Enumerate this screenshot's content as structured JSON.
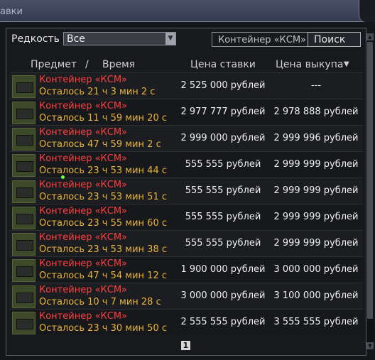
{
  "window": {
    "title": "авки"
  },
  "filter": {
    "rarity_label": "Редкость",
    "rarity_value": "Все",
    "search_value": "Контейнер «КСМ»",
    "search_button": "Поиск"
  },
  "table": {
    "col_item": "Предмет",
    "col_sep": "/",
    "col_time": "Время",
    "col_bid": "Цена ставки",
    "col_buyout": "Цена выкупа",
    "sort_indicator": "▼",
    "rows": [
      {
        "name": "Контейнер «КСМ»",
        "time": "Осталось 21 ч 3 мин 2 с",
        "bid": "2 525 000 рублей",
        "buyout": "---"
      },
      {
        "name": "Контейнер «КСМ»",
        "time": "Осталось 11 ч 59 мин 20 с",
        "bid": "2 977 777 рублей",
        "buyout": "2 978 888 рублей"
      },
      {
        "name": "Контейнер «КСМ»",
        "time": "Осталось 47 ч 59 мин 2 с",
        "bid": "2 999 000 рублей",
        "buyout": "2 999 996 рублей"
      },
      {
        "name": "Контейнер «КСМ»",
        "time": "Осталось 23 ч 53 мин 44 с",
        "bid": "555 555 рублей",
        "buyout": "2 999 999 рублей"
      },
      {
        "name": "Контейнер «КСМ»",
        "time": "Осталось 23 ч 53 мин 51 с",
        "bid": "555 555 рублей",
        "buyout": "2 999 999 рублей"
      },
      {
        "name": "Контейнер «КСМ»",
        "time": "Осталось 23 ч 55 мин 60 с",
        "bid": "555 555 рублей",
        "buyout": "2 999 999 рублей"
      },
      {
        "name": "Контейнер «КСМ»",
        "time": "Осталось 23 ч 53 мин 38 с",
        "bid": "555 555 рублей",
        "buyout": "2 999 999 рублей"
      },
      {
        "name": "Контейнер «КСМ»",
        "time": "Осталось 47 ч 54 мин 12 с",
        "bid": "1 900 000 рублей",
        "buyout": "3 000 000 рублей"
      },
      {
        "name": "Контейнер «КСМ»",
        "time": "Осталось 10 ч 7 мин 28 с",
        "bid": "3 000 000 рублей",
        "buyout": "3 100 000 рублей"
      },
      {
        "name": "Контейнер «КСМ»",
        "time": "Осталось 23 ч 30 мин 50 с",
        "bid": "2 555 555 рублей",
        "buyout": "3 555 555 рублей"
      }
    ]
  },
  "pager": {
    "current_page": "1"
  },
  "colors": {
    "item_name": "#ff4040",
    "time_left": "#e8b33a",
    "title_bar": "#4a5066"
  },
  "icons": {
    "select_arrow": "chevron-down-icon",
    "item_thumb": "container-icon"
  }
}
